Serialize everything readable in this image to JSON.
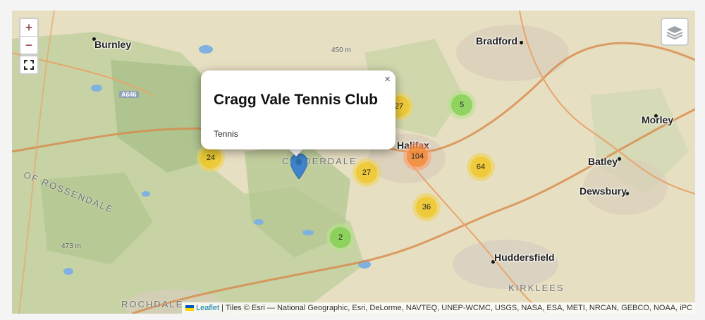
{
  "map": {
    "popup": {
      "title": "Cragg Vale Tennis Club",
      "category": "Tennis",
      "close_symbol": "×"
    },
    "controls": {
      "zoom_in": "+",
      "zoom_out": "−"
    },
    "places": [
      "Burnley",
      "Bradford",
      "Morley",
      "Batley",
      "Dewsbury",
      "Huddersfield",
      "Halifax"
    ],
    "regions": [
      "KIRKLEES",
      "ROCHDALE",
      "CALDERDALE",
      "OF ROSSENDALE"
    ],
    "spot_heights": [
      "450 m",
      "473 m"
    ],
    "road_label": "A646",
    "clusters": [
      {
        "count": "27",
        "size": "medium"
      },
      {
        "count": "5",
        "size": "small"
      },
      {
        "count": "24",
        "size": "medium"
      },
      {
        "count": "104",
        "size": "large"
      },
      {
        "count": "27",
        "size": "medium"
      },
      {
        "count": "64",
        "size": "medium"
      },
      {
        "count": "36",
        "size": "medium"
      },
      {
        "count": "2",
        "size": "small"
      }
    ],
    "attribution": {
      "link": "Leaflet",
      "text": " | Tiles © Esri — National Geographic, Esri, DeLorme, NAVTEQ, UNEP-WCMC, USGS, NASA, ESA, METI, NRCAN, GEBCO, NOAA, iPC"
    },
    "colors": {
      "marker": "#3f84c9",
      "zoom_icon": "#7a1c1c"
    }
  }
}
